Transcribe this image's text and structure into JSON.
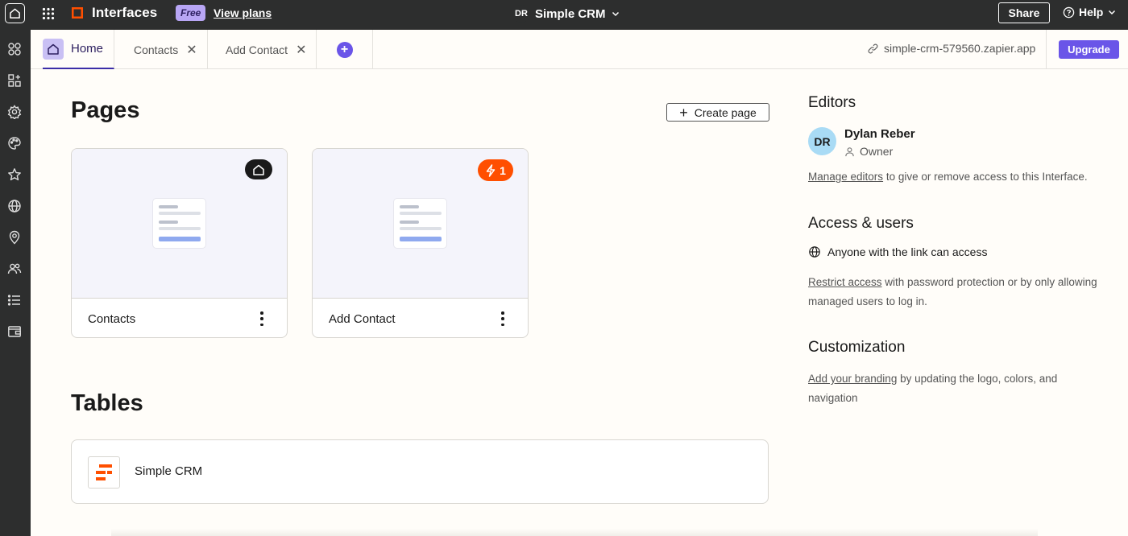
{
  "topbar": {
    "app_name": "Interfaces",
    "plan_badge": "Free",
    "view_plans": "View plans",
    "project_initials": "DR",
    "project_name": "Simple CRM",
    "share_label": "Share",
    "help_label": "Help",
    "brand_color": "#ff4f00"
  },
  "rail": {
    "icons": [
      "apps-icon",
      "add-app-icon",
      "settings-icon",
      "palette-icon",
      "star-icon",
      "globe-icon",
      "location-icon",
      "users-icon",
      "list-icon",
      "wallet-icon"
    ]
  },
  "tabs": {
    "home": "Home",
    "contacts": "Contacts",
    "add_contact": "Add Contact",
    "url": "simple-crm-579560.zapier.app",
    "upgrade": "Upgrade",
    "accent_color": "#6a55e8"
  },
  "pages": {
    "title": "Pages",
    "create_label": "Create page",
    "cards": [
      {
        "name": "Contacts",
        "badge": "home"
      },
      {
        "name": "Add Contact",
        "badge": "trigger",
        "badge_count": "1"
      }
    ]
  },
  "tables": {
    "title": "Tables",
    "items": [
      {
        "name": "Simple CRM"
      }
    ]
  },
  "panel": {
    "editors_title": "Editors",
    "editor_initials": "DR",
    "editor_name": "Dylan Reber",
    "editor_role": "Owner",
    "manage_link": "Manage editors",
    "manage_rest": " to give or remove access to this Interface.",
    "access_title": "Access & users",
    "access_line": "Anyone with the link can access",
    "restrict_link": "Restrict access",
    "restrict_rest": " with password protection or by only allowing managed users to log in.",
    "custom_title": "Customization",
    "branding_link": "Add your branding",
    "branding_rest": " by updating the logo, colors, and navigation"
  }
}
